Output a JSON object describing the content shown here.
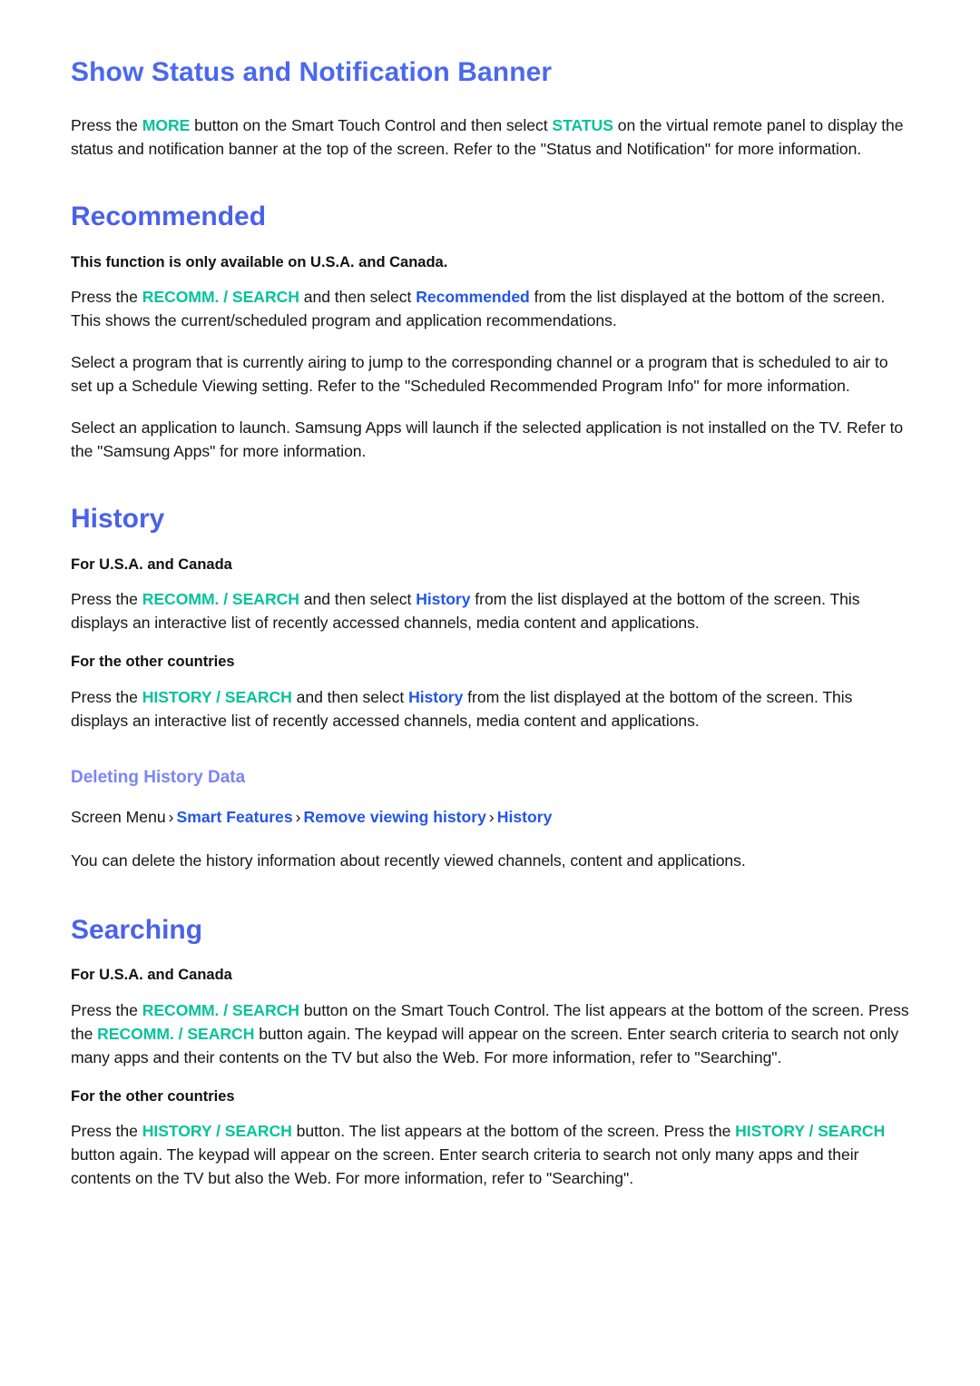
{
  "colors": {
    "heading_primary": "#4a68ef",
    "heading_section": "#4a62ea",
    "heading_sub": "#7b86f5",
    "key_teal": "#06c39b",
    "link_blue": "#2356e8",
    "body_text": "#161616",
    "page_background": "#ffffff"
  },
  "sections": {
    "status_banner": {
      "heading": "Show Status and Notification Banner",
      "paragraph": {
        "p1": "Press the ",
        "key1": "MORE",
        "p2": " button on the Smart Touch Control and then select ",
        "key2": "STATUS",
        "p3": " on the virtual remote panel to display the status and notification banner at the top of the screen. Refer to the \"Status and Notification\" for more information."
      }
    },
    "recommended": {
      "heading": "Recommended",
      "note": "This function is only available on U.S.A. and Canada.",
      "paragraph1": {
        "p1": "Press the ",
        "key1": "RECOMM. / SEARCH",
        "p2": " and then select ",
        "link1": "Recommended",
        "p3": " from the list displayed at the bottom of the screen. This shows the current/scheduled program and application recommendations."
      },
      "paragraph2": "Select a program that is currently airing to jump to the corresponding channel or a program that is scheduled to air to set up a Schedule Viewing setting. Refer to the \"Scheduled Recommended Program Info\" for more information.",
      "paragraph3": "Select an application to launch. Samsung Apps will launch if the selected application is not installed on the TV. Refer to the \"Samsung Apps\" for more information."
    },
    "history": {
      "heading": "History",
      "usa_label": "For U.S.A. and Canada",
      "usa_paragraph": {
        "p1": "Press the ",
        "key1": "RECOMM. / SEARCH",
        "p2": " and then select ",
        "link1": "History",
        "p3": " from the list displayed at the bottom of the screen. This displays an interactive list of recently accessed channels, media content and applications."
      },
      "other_label": "For the other countries",
      "other_paragraph": {
        "p1": "Press the ",
        "key1": "HISTORY / SEARCH",
        "p2": " and then select ",
        "link1": "History",
        "p3": " from the list displayed at the bottom of the screen. This displays an interactive list of recently accessed channels, media content and applications."
      },
      "deleting": {
        "heading": "Deleting History Data",
        "breadcrumb": {
          "root": "Screen Menu",
          "separator": "›",
          "items": [
            "Smart Features",
            "Remove viewing history",
            "History"
          ]
        },
        "paragraph": "You can delete the history information about recently viewed channels, content and applications."
      }
    },
    "searching": {
      "heading": "Searching",
      "usa_label": "For U.S.A. and Canada",
      "usa_paragraph": {
        "p1": "Press the ",
        "key1": "RECOMM. / SEARCH",
        "p2": " button on the Smart Touch Control. The list appears at the bottom of the screen. Press the ",
        "key2": "RECOMM. / SEARCH",
        "p3": " button again. The keypad will appear on the screen. Enter search criteria to search not only many apps and their contents on the TV but also the Web. For more information, refer to \"Searching\"."
      },
      "other_label": "For the other countries",
      "other_paragraph": {
        "p1": "Press the ",
        "key1": "HISTORY / SEARCH",
        "p2": " button. The list appears at the bottom of the screen. Press the ",
        "key2": "HISTORY / SEARCH",
        "p3": " button again. The keypad will appear on the screen. Enter search criteria to search not only many apps and their contents on the TV but also the Web. For more information, refer to \"Searching\"."
      }
    }
  }
}
